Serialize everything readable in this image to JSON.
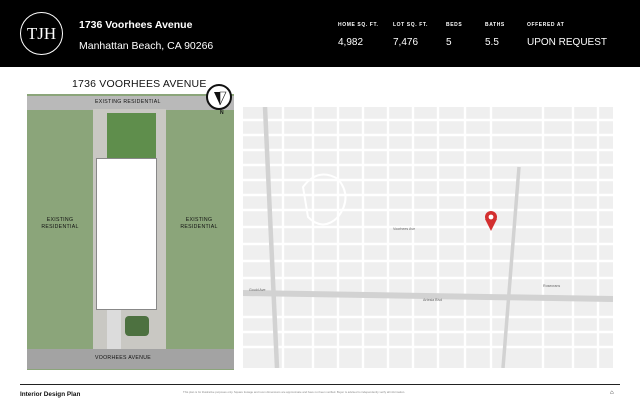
{
  "header": {
    "logo_text": "TJH",
    "street": "1736 Voorhees Avenue",
    "city_line": "Manhattan Beach, CA 90266",
    "stats": [
      {
        "label": "HOME SQ. FT.",
        "value": "4,982"
      },
      {
        "label": "LOT SQ. FT.",
        "value": "7,476"
      },
      {
        "label": "BEDS",
        "value": "5"
      },
      {
        "label": "BATHS",
        "value": "5.5"
      },
      {
        "label": "OFFERED AT",
        "value": "UPON REQUEST"
      }
    ]
  },
  "site_plan": {
    "title": "1736 VOORHEES AVENUE",
    "top_label": "EXISTING RESIDENTIAL",
    "left_label": "EXISTING\nRESIDENTIAL",
    "right_label": "EXISTING\nRESIDENTIAL",
    "bottom_label": "VOORHEES AVENUE",
    "north_label": "N"
  },
  "map": {
    "pin_color": "#d32f2f",
    "streets": [
      "Artesia Blvd",
      "Gould Ave",
      "Voorhees Ave",
      "Rosecrans",
      "Sepulveda Blvd",
      "Aviation Blvd"
    ]
  },
  "footer": {
    "title": "Interior Design Plan",
    "disclaimer": "This plan is for illustrative purposes only. Square footage and room dimensions are approximate and have not been verified. Buyer is advised to independently verify all information.",
    "icon": "equal-housing-icon"
  }
}
